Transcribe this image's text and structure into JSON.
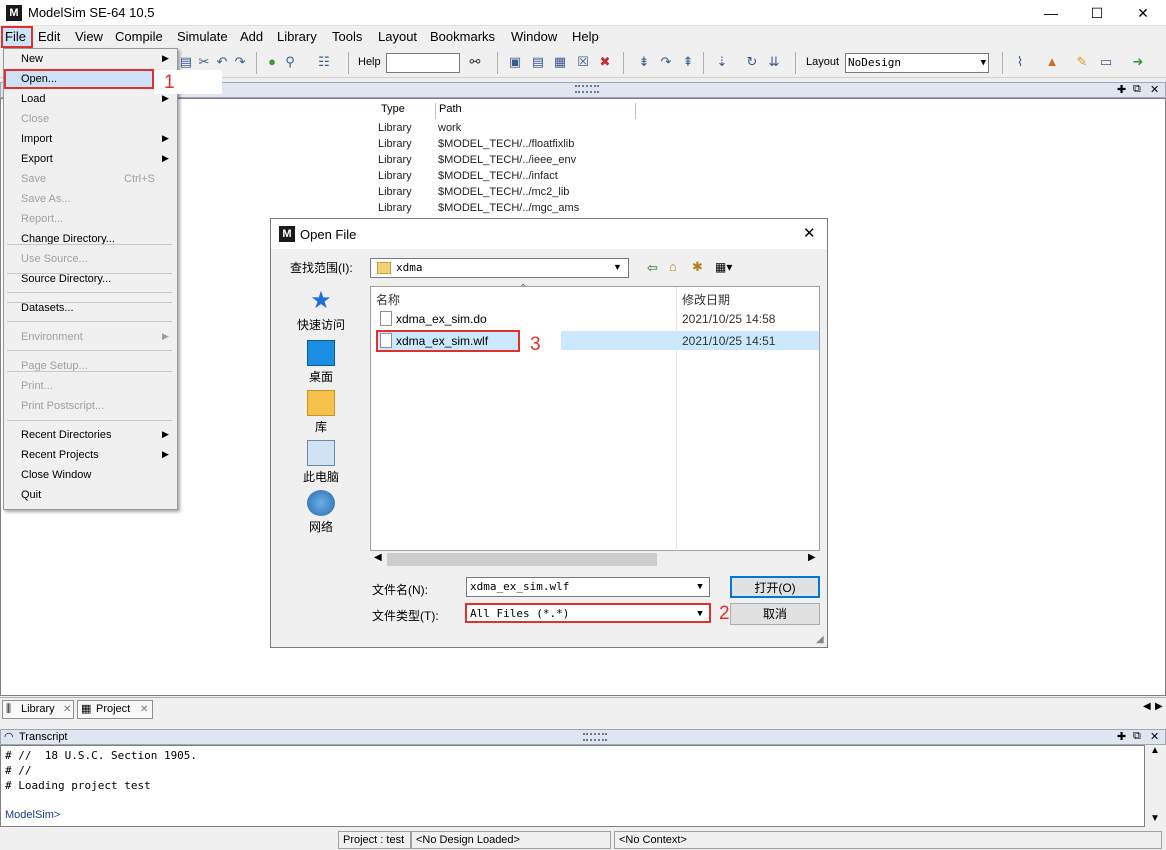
{
  "window": {
    "title": "ModelSim SE-64 10.5",
    "icon_letter": "M",
    "minimize": "—",
    "maximize": "☐",
    "close": "✕"
  },
  "menubar": [
    "File",
    "Edit",
    "View",
    "Compile",
    "Simulate",
    "Add",
    "Library",
    "Tools",
    "Layout",
    "Bookmarks",
    "Window",
    "Help"
  ],
  "toolbar": {
    "help_label": "Help",
    "help_value": "",
    "layout_label": "Layout",
    "layout_value": "NoDesign"
  },
  "library_pane": {
    "columns": [
      "Type",
      "Path"
    ],
    "rows": [
      {
        "type": "Library",
        "path": "work"
      },
      {
        "type": "Library",
        "path": "$MODEL_TECH/../floatfixlib"
      },
      {
        "type": "Library",
        "path": "$MODEL_TECH/../ieee_env"
      },
      {
        "type": "Library",
        "path": "$MODEL_TECH/../infact"
      },
      {
        "type": "Library",
        "path": "$MODEL_TECH/../mc2_lib"
      },
      {
        "type": "Library",
        "path": "$MODEL_TECH/../mgc_ams"
      }
    ]
  },
  "file_menu": {
    "items": [
      {
        "label": "New",
        "submenu": true
      },
      {
        "label": "Open...",
        "highlighted": true
      },
      {
        "label": "Load",
        "submenu": true
      },
      {
        "label": "Close",
        "disabled": true
      },
      {
        "label": "Import",
        "submenu": true
      },
      {
        "label": "Export",
        "submenu": true
      },
      {
        "label": "Save",
        "disabled": true,
        "shortcut": "Ctrl+S"
      },
      {
        "label": "Save As...",
        "disabled": true
      },
      {
        "label": "Report...",
        "disabled": true
      },
      {
        "label": "Change Directory..."
      },
      {
        "label": "Use Source...",
        "disabled": true
      },
      {
        "label": "Source Directory..."
      },
      {
        "label": "Datasets..."
      },
      {
        "label": "Environment",
        "disabled": true,
        "submenu": true
      },
      {
        "label": "Page Setup...",
        "disabled": true
      },
      {
        "label": "Print...",
        "disabled": true
      },
      {
        "label": "Print Postscript...",
        "disabled": true
      },
      {
        "label": "Recent Directories",
        "submenu": true
      },
      {
        "label": "Recent Projects",
        "submenu": true
      },
      {
        "label": "Close Window"
      },
      {
        "label": "Quit"
      }
    ]
  },
  "annotations": [
    "1",
    "2",
    "3"
  ],
  "open_dialog": {
    "title": "Open File",
    "lookin_label": "查找范围(I):",
    "lookin_value": "xdma",
    "places": [
      "快速访问",
      "桌面",
      "库",
      "此电脑",
      "网络"
    ],
    "columns": {
      "name": "名称",
      "modified": "修改日期"
    },
    "files": [
      {
        "name": "xdma_ex_sim.do",
        "modified": "2021/10/25 14:58"
      },
      {
        "name": "xdma_ex_sim.wlf",
        "modified": "2021/10/25 14:51",
        "selected": true
      }
    ],
    "filename_label": "文件名(N):",
    "filename_value": "xdma_ex_sim.wlf",
    "filetype_label": "文件类型(T):",
    "filetype_value": "All Files (*.*)",
    "open_button": "打开(O)",
    "cancel_button": "取消"
  },
  "tabs": [
    "Library",
    "Project"
  ],
  "transcript": {
    "title": "Transcript",
    "lines": [
      "# //  18 U.S.C. Section 1905.",
      "# //",
      "# Loading project test"
    ],
    "prompt": "ModelSim>"
  },
  "status": {
    "project": "Project : test",
    "design": "<No Design Loaded>",
    "context": "<No Context>"
  },
  "colors": {
    "highlight_red": "#e0312f",
    "selection_blue": "#cce8ff",
    "app_icon": "#1a1a1a"
  }
}
